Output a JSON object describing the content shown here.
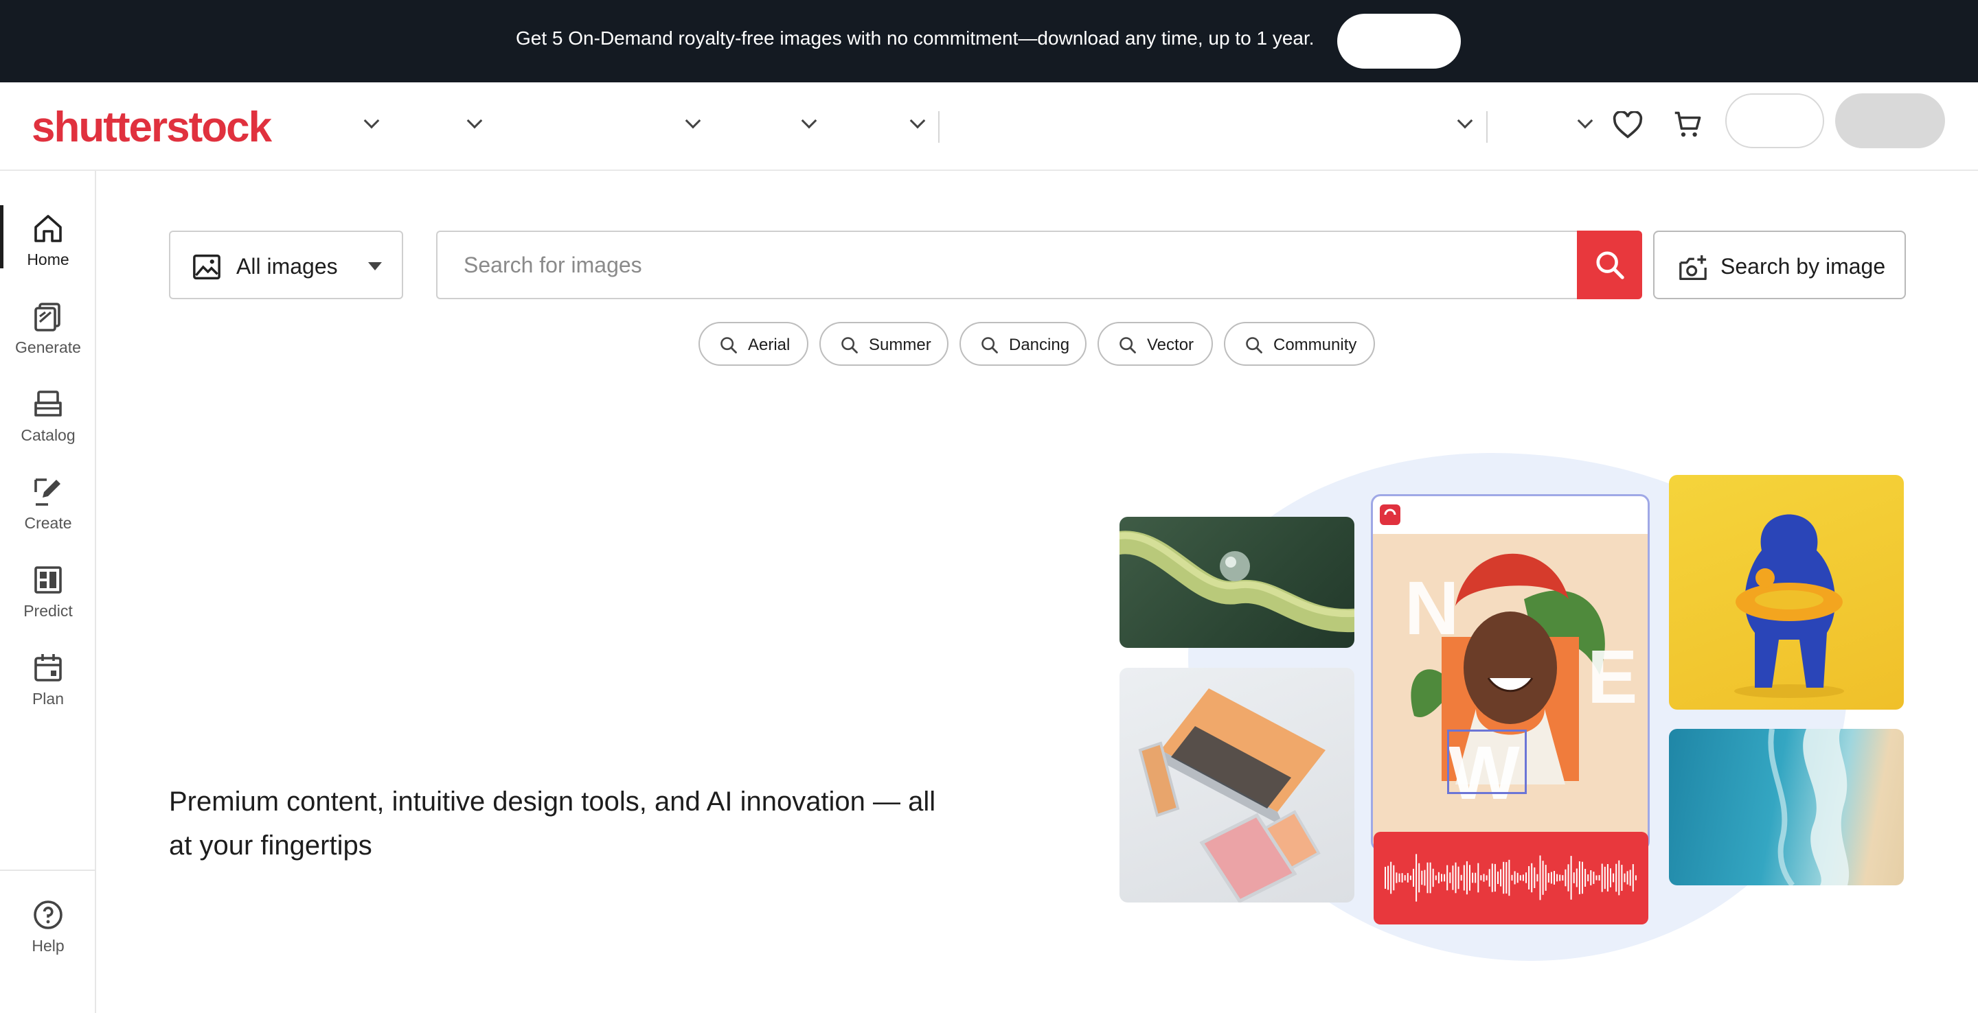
{
  "promo": {
    "text": "Get 5 On-Demand royalty-free images with no commitment—download any time, up to 1 year.",
    "button_label": ""
  },
  "header": {
    "logo": "shutterstock",
    "login_label": "",
    "signup_label": ""
  },
  "sidebar": {
    "items": [
      {
        "label": "Home",
        "icon": "home-icon",
        "active": true
      },
      {
        "label": "Generate",
        "icon": "generate-icon"
      },
      {
        "label": "Catalog",
        "icon": "catalog-icon"
      },
      {
        "label": "Create",
        "icon": "create-icon"
      },
      {
        "label": "Predict",
        "icon": "predict-icon"
      },
      {
        "label": "Plan",
        "icon": "calendar-icon"
      }
    ],
    "help": {
      "label": "Help",
      "icon": "help-icon"
    }
  },
  "search": {
    "type_selected": "All images",
    "placeholder": "Search for images",
    "value": "",
    "image_search_label": "Search by image"
  },
  "chips": [
    {
      "label": "Aerial"
    },
    {
      "label": "Summer"
    },
    {
      "label": "Dancing"
    },
    {
      "label": "Vector"
    },
    {
      "label": "Community"
    }
  ],
  "hero": {
    "tagline": "Premium content, intuitive design tools, and AI innovation — all at your fingertips",
    "portrait_letters": [
      "N",
      "E",
      "W"
    ]
  },
  "colors": {
    "brand": "#e0313e",
    "search_button": "#e8383d",
    "banner_bg": "#141a22"
  }
}
